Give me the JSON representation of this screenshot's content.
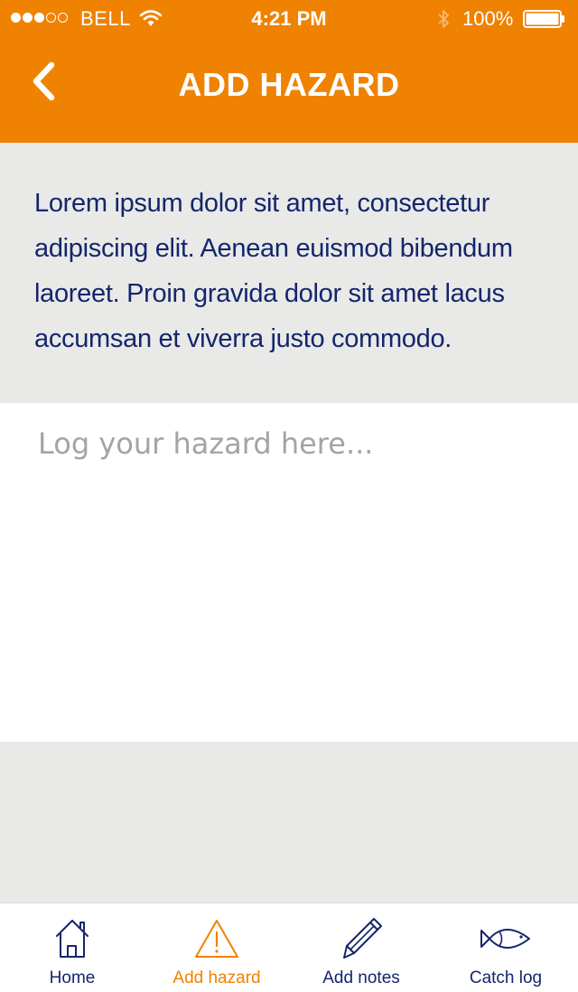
{
  "status_bar": {
    "signal_full": 3,
    "signal_empty": 2,
    "carrier": "BELL",
    "wifi_icon": "wifi-icon",
    "time": "4:21 PM",
    "bluetooth_icon": "bluetooth-icon",
    "battery_percent": "100%",
    "battery_icon": "battery-icon",
    "battery_level": 1.0
  },
  "nav": {
    "title": "ADD HAZARD",
    "back_icon": "chevron-left-icon"
  },
  "intro": {
    "text": "Lorem ipsum dolor sit amet, consectetur adipiscing elit. Aenean euismod bibendum laoreet. Proin gravida dolor sit amet lacus accumsan et viverra justo commodo."
  },
  "hazard_input": {
    "placeholder": "Log your hazard here...",
    "value": ""
  },
  "tabs": [
    {
      "label": "Home",
      "icon": "home-icon",
      "active": false
    },
    {
      "label": "Add hazard",
      "icon": "warning-icon",
      "active": true
    },
    {
      "label": "Add notes",
      "icon": "pencil-icon",
      "active": false
    },
    {
      "label": "Catch log",
      "icon": "fish-icon",
      "active": false
    }
  ],
  "colors": {
    "accent": "#ef8200",
    "navy": "#14266b",
    "background": "#e9e9e8",
    "placeholder": "#a4a4a4",
    "white": "#ffffff"
  }
}
